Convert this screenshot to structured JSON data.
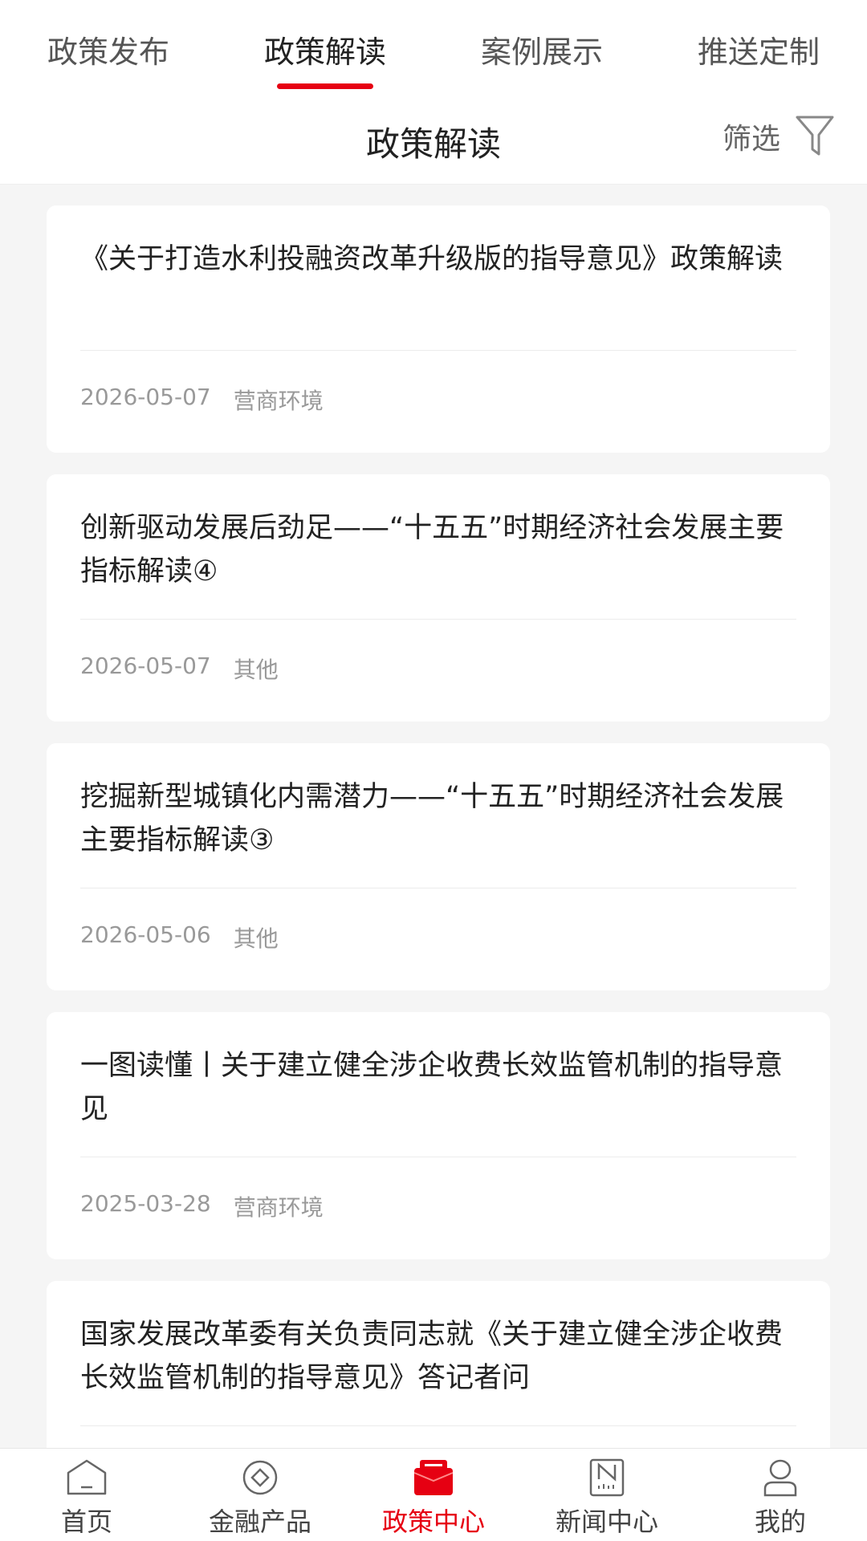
{
  "top_tabs": [
    {
      "label": "政策发布"
    },
    {
      "label": "政策解读"
    },
    {
      "label": "案例展示"
    },
    {
      "label": "推送定制"
    }
  ],
  "active_top_tab": "政策解读",
  "header": {
    "title": "政策解读",
    "filter_label": "筛选",
    "filter_icon": "filter-icon"
  },
  "articles": [
    {
      "title": "《关于打造水利投融资改革升级版的指导意见》政策解读",
      "date": "2026-05-07",
      "category": "营商环境"
    },
    {
      "title": "创新驱动发展后劲足——“十五五”时期经济社会发展主要指标解读④",
      "date": "2026-05-07",
      "category": "其他"
    },
    {
      "title": "挖掘新型城镇化内需潜力——“十五五”时期经济社会发展主要指标解读③",
      "date": "2026-05-06",
      "category": "其他"
    },
    {
      "title": "一图读懂丨关于建立健全涉企收费长效监管机制的指导意见",
      "date": "2025-03-28",
      "category": "营商环境"
    },
    {
      "title": "国家发展改革委有关负责同志就《关于建立健全涉企收费长效监管机制的指导意见》答记者问",
      "date": "",
      "category": ""
    }
  ],
  "bottom_nav": [
    {
      "label": "首页",
      "icon": "home-icon"
    },
    {
      "label": "金融产品",
      "icon": "diamond-icon"
    },
    {
      "label": "政策中心",
      "icon": "policy-folder-icon"
    },
    {
      "label": "新闻中心",
      "icon": "news-icon"
    },
    {
      "label": "我的",
      "icon": "profile-icon"
    }
  ],
  "active_bottom_nav": "政策中心",
  "colors": {
    "accent": "#e60012",
    "text": "#222222",
    "muted": "#999999",
    "background": "#f5f5f5"
  }
}
